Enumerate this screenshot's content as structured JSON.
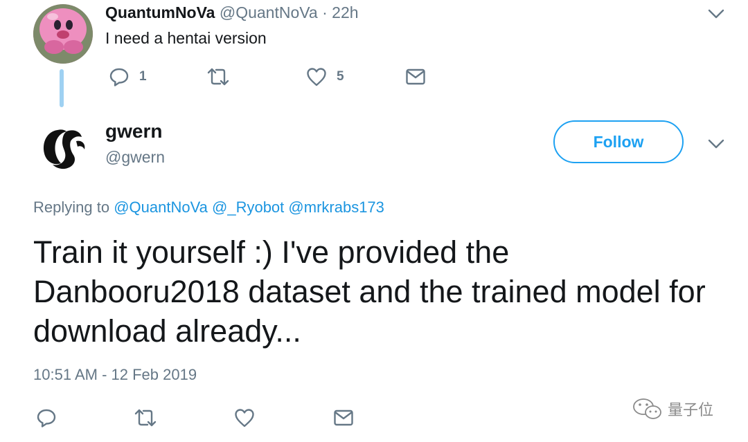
{
  "reply_tweet": {
    "display_name": "QuantumNoVa",
    "handle": "@QuantNoVa",
    "separator": "·",
    "time": "22h",
    "text": "I need a hentai version",
    "actions": {
      "reply_count": "1",
      "like_count": "5"
    }
  },
  "main_tweet": {
    "display_name": "gwern",
    "handle": "@gwern",
    "follow_label": "Follow",
    "replying_prefix": "Replying to",
    "mentions": [
      "@QuantNoVa",
      "@_Ryobot",
      "@mrkrabs173"
    ],
    "text": "Train it yourself :) I've provided the Danbooru2018 dataset and the trained model for download already...",
    "timestamp": "10:51 AM - 12 Feb 2019"
  },
  "watermark": {
    "text": "量子位"
  },
  "colors": {
    "accent": "#1da1f2",
    "mention": "#1b95e0",
    "muted": "#657786",
    "text": "#14171a",
    "thread_line": "#9fd1f2"
  },
  "icons": [
    "reply-icon",
    "retweet-icon",
    "like-icon",
    "message-icon",
    "chevron-down-icon",
    "wechat-logo-icon"
  ]
}
